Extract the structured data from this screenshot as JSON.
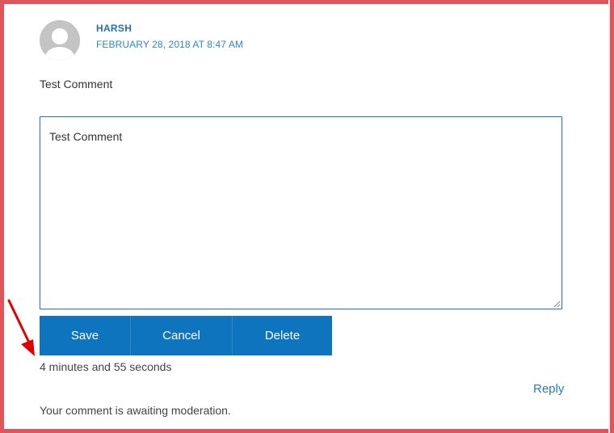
{
  "comment": {
    "author": "HARSH",
    "date": "FEBRUARY 28, 2018 AT 8:47 AM",
    "text": "Test Comment",
    "awaiting": "Your comment is awaiting moderation."
  },
  "editor": {
    "value": "Test Comment",
    "save_label": "Save",
    "cancel_label": "Cancel",
    "delete_label": "Delete",
    "timer": "4 minutes and 55 seconds"
  },
  "actions": {
    "reply_label": "Reply"
  },
  "colors": {
    "frame_border": "#e2545a",
    "accent": "#0e74bd",
    "link": "#2a7ab8",
    "arrow": "#e00000"
  },
  "icons": {
    "avatar": "default-avatar-icon",
    "annotation": "red-arrow-icon"
  }
}
